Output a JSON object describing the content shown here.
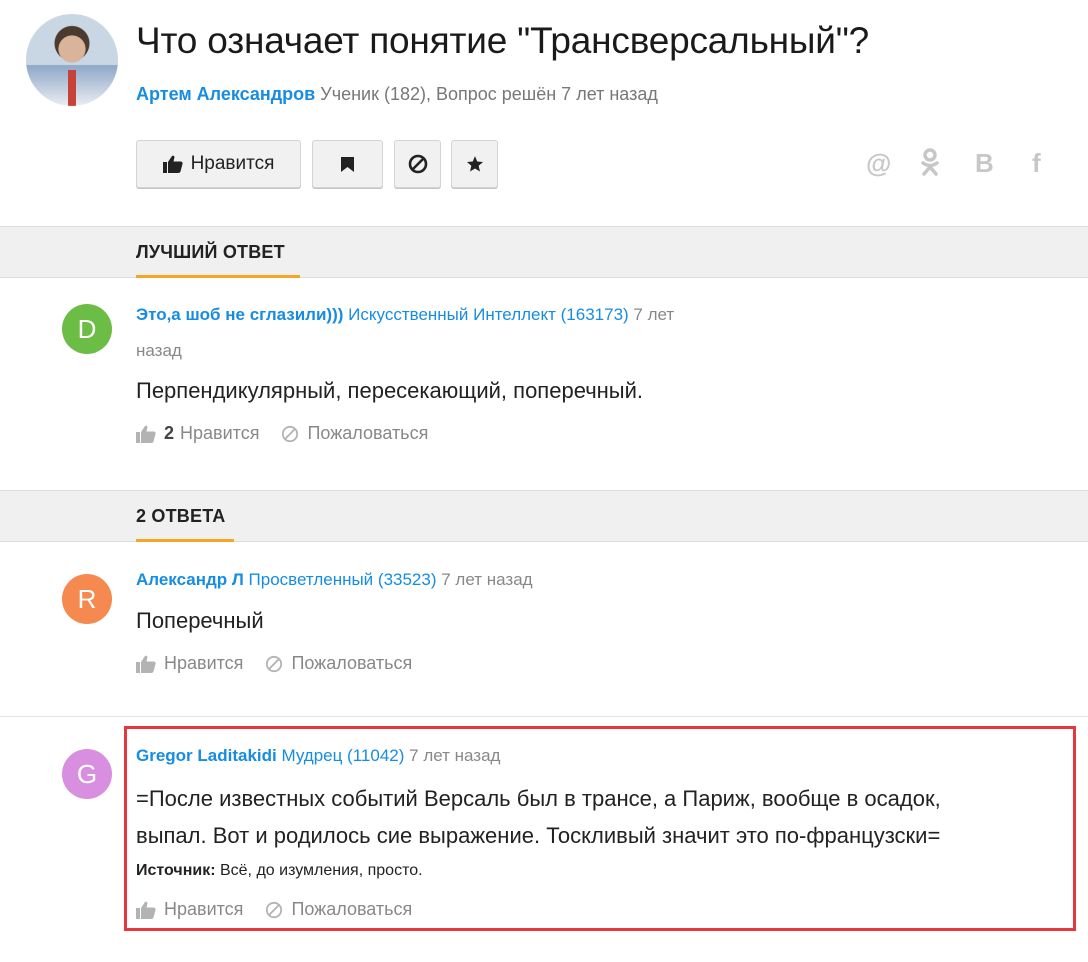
{
  "question": {
    "title": "Что означает понятие \"Трансверсальный\"?",
    "author": "Артем Александров",
    "author_meta": "Ученик (182), Вопрос решён 7 лет назад"
  },
  "toolbar": {
    "like_label": "Нравится"
  },
  "share": {
    "mail": "@",
    "ok": "ok",
    "vk": "B",
    "fb": "f"
  },
  "sections": {
    "best": "ЛУЧШИЙ ОТВЕТ",
    "answers": "2 ОТВЕТА"
  },
  "best_answer": {
    "avatar_letter": "D",
    "avatar_color": "#6cbd45",
    "name": "Это,а шоб не сглазили)))",
    "rank": "Искусственный Интеллект (163173)",
    "time_line1": "7 лет",
    "time_line2": "назад",
    "text": "Перпендикулярный, пересекающий, поперечный.",
    "likes": "2",
    "like_label": "Нравится",
    "report_label": "Пожаловаться"
  },
  "answers": [
    {
      "avatar_letter": "R",
      "avatar_color": "#f5894f",
      "name": "Александр Л",
      "rank": "Просветленный (33523)",
      "time": "7 лет назад",
      "text": "Поперечный",
      "like_label": "Нравится",
      "report_label": "Пожаловаться"
    },
    {
      "avatar_letter": "G",
      "avatar_color": "#d98fe0",
      "name": "Gregor Laditakidi",
      "rank": "Мудрец (11042)",
      "time": "7 лет назад",
      "text_line1": "=После известных событий Версаль был в трансе, а Париж, вообще в осадок,",
      "text_line2": "выпал. Вот и родилось сие выражение. Тоскливый значит это по-французски=",
      "source_label": "Источник:",
      "source_text": "Всё, до изумления, просто.",
      "like_label": "Нравится",
      "report_label": "Пожаловаться"
    }
  ]
}
